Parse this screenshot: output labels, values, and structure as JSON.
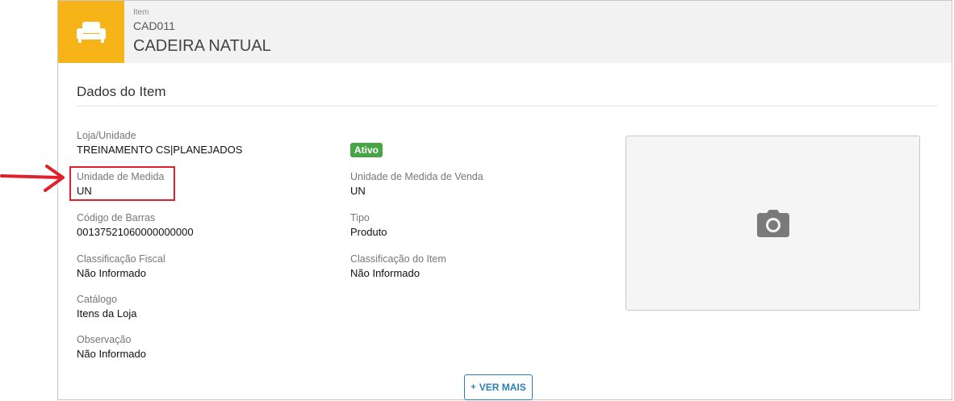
{
  "header": {
    "item_label": "Item",
    "item_code": "CAD011",
    "item_name": "CADEIRA NATUAL",
    "icon": "armchair-icon"
  },
  "section": {
    "title": "Dados do Item"
  },
  "fields": {
    "loja_unidade": {
      "label": "Loja/Unidade",
      "value": "TREINAMENTO CS|PLANEJADOS"
    },
    "unidade_medida": {
      "label": "Unidade de Medida",
      "value": "UN"
    },
    "codigo_barras": {
      "label": "Código de Barras",
      "value": "00137521060000000000"
    },
    "classificacao_fiscal": {
      "label": "Classificação Fiscal",
      "value": "Não Informado"
    },
    "catalogo": {
      "label": "Catálogo",
      "value": "Itens da Loja"
    },
    "observacao": {
      "label": "Observação",
      "value": "Não Informado"
    },
    "unidade_medida_venda": {
      "label": "Unidade de Medida de Venda",
      "value": "UN"
    },
    "tipo": {
      "label": "Tipo",
      "value": "Produto"
    },
    "classificacao_item": {
      "label": "Classificação do Item",
      "value": "Não Informado"
    }
  },
  "status_badge": {
    "label": "Ativo",
    "color": "#47a447"
  },
  "photo": {
    "icon": "camera-icon"
  },
  "ver_mais": {
    "label": "VER MAIS",
    "icon": "plus-icon"
  },
  "colors": {
    "accent": "#f6b418",
    "highlight": "#e0202a",
    "link": "#2d7fb8"
  }
}
